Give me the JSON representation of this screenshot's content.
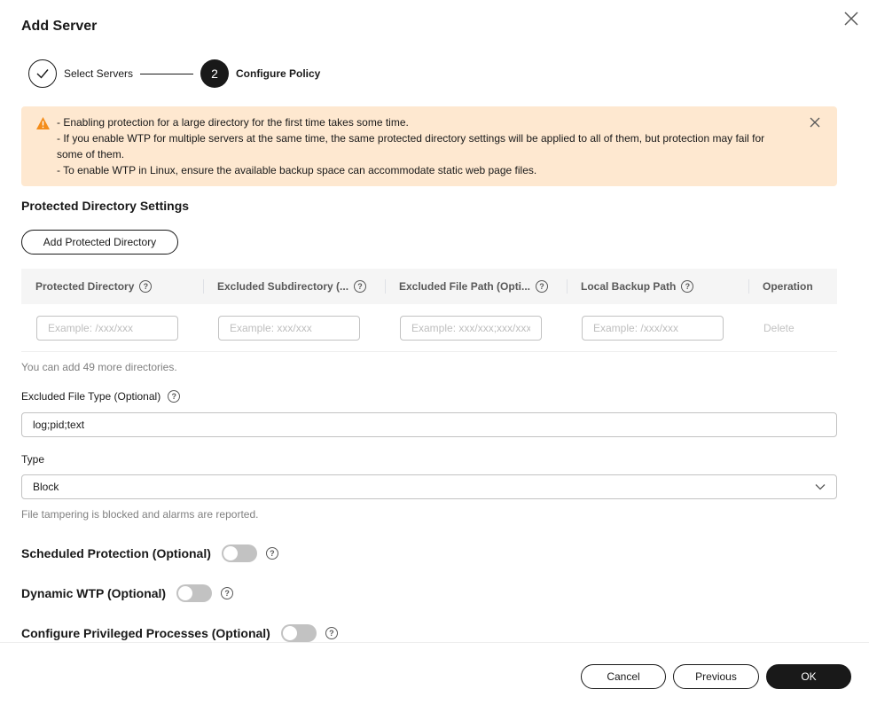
{
  "dialog": {
    "title": "Add Server"
  },
  "steps": [
    {
      "label": "Select Servers",
      "status": "done",
      "icon": "check-icon"
    },
    {
      "number": "2",
      "label": "Configure Policy",
      "status": "active"
    }
  ],
  "alert": {
    "icon": "warning-icon",
    "color": "#fee8d0",
    "lines": [
      "- Enabling protection for a large directory for the first time takes some time.",
      "- If you enable WTP for multiple servers at the same time, the same protected directory settings will be applied to all of them, but protection may fail for some of them.",
      "- To enable WTP in Linux, ensure the available backup space can accommodate static web page files."
    ]
  },
  "protected_dirs": {
    "section_title": "Protected Directory Settings",
    "add_button": "Add Protected Directory",
    "columns": [
      "Protected Directory",
      "Excluded Subdirectory (...",
      "Excluded File Path (Opti...",
      "Local Backup Path",
      "Operation"
    ],
    "row": {
      "placeholders": [
        "Example: /xxx/xxx",
        "Example: xxx/xxx",
        "Example: xxx/xxx;xxx/xxx",
        "Example: /xxx/xxx"
      ],
      "delete_label": "Delete"
    },
    "remaining_hint": "You can add 49 more directories."
  },
  "excluded_file_type": {
    "label": "Excluded File Type (Optional)",
    "value": "log;pid;text"
  },
  "type": {
    "label": "Type",
    "value": "Block",
    "hint": "File tampering is blocked and alarms are reported."
  },
  "toggles": [
    {
      "label": "Scheduled Protection (Optional)",
      "enabled": false
    },
    {
      "label": "Dynamic WTP (Optional)",
      "enabled": false
    },
    {
      "label": "Configure Privileged Processes (Optional)",
      "enabled": false
    }
  ],
  "footer": {
    "cancel": "Cancel",
    "previous": "Previous",
    "ok": "OK"
  }
}
